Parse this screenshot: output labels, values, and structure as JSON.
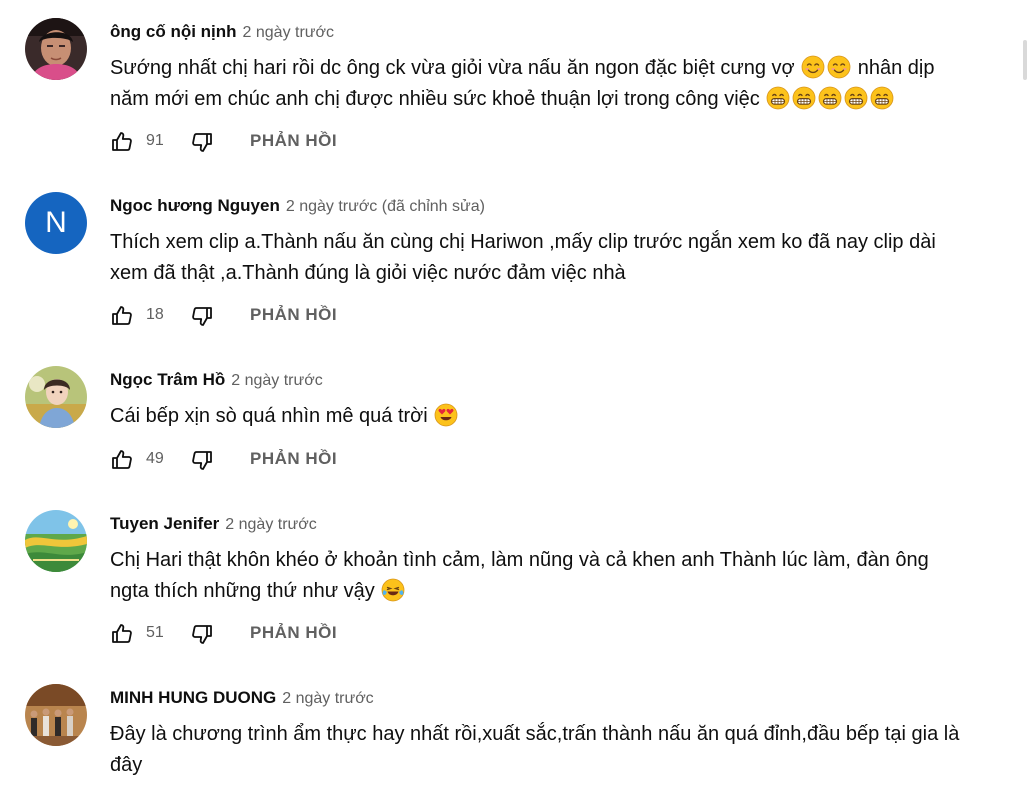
{
  "reply_label": "PHẢN HỒI",
  "comments": [
    {
      "author": "ông cố nội nịnh",
      "meta": "2 ngày trước",
      "lines": [
        "Sướng nhất chị hari rồi dc ông ck vừa giỏi vừa nấu ăn ngon đặc biệt cưng vợ",
        "nhân dịp",
        "năm mới em chúc anh chị được nhiều sức khoẻ thuận lợi trong công việc"
      ],
      "likes": "91"
    },
    {
      "author": "Ngoc hương Nguyen",
      "meta": "2 ngày trước (đã chỉnh sửa)",
      "avatar_letter": "N",
      "lines": [
        "Thích xem clip a.Thành nấu ăn cùng chị Hariwon ,mấy clip trước ngắn xem ko đã nay clip dài",
        "xem đã thật ,a.Thành đúng là giỏi việc nước đảm việc nhà"
      ],
      "likes": "18"
    },
    {
      "author": "Ngọc Trâm Hồ",
      "meta": "2 ngày trước",
      "lines": [
        "Cái bếp xịn sò quá nhìn mê quá trời"
      ],
      "likes": "49"
    },
    {
      "author": "Tuyen Jenifer",
      "meta": "2 ngày trước",
      "lines": [
        "Chị Hari thật khôn khéo ở khoản tình cảm, làm nũng và cả khen anh Thành lúc làm, đàn ông",
        "ngta thích những thứ như vậy"
      ],
      "likes": "51"
    },
    {
      "author": "MINH HUNG DUONG",
      "meta": "2 ngày trước",
      "lines": [
        "Đây là chương trình ẩm thực hay nhất rồi,xuất sắc,trấn thành nấu ăn quá đỉnh,đầu bếp tại gia là",
        "đây"
      ]
    }
  ],
  "colors": {
    "text": "#0f0f0f",
    "secondary": "#606060",
    "avatar_n_bg": "#1565c0",
    "emoji_yellow": "#fcc21b"
  },
  "icons": [
    "thumb-up-icon",
    "thumb-down-icon",
    "smiling-face-emoji",
    "grinning-face-emoji",
    "heart-eyes-emoji",
    "laughing-tears-emoji"
  ]
}
